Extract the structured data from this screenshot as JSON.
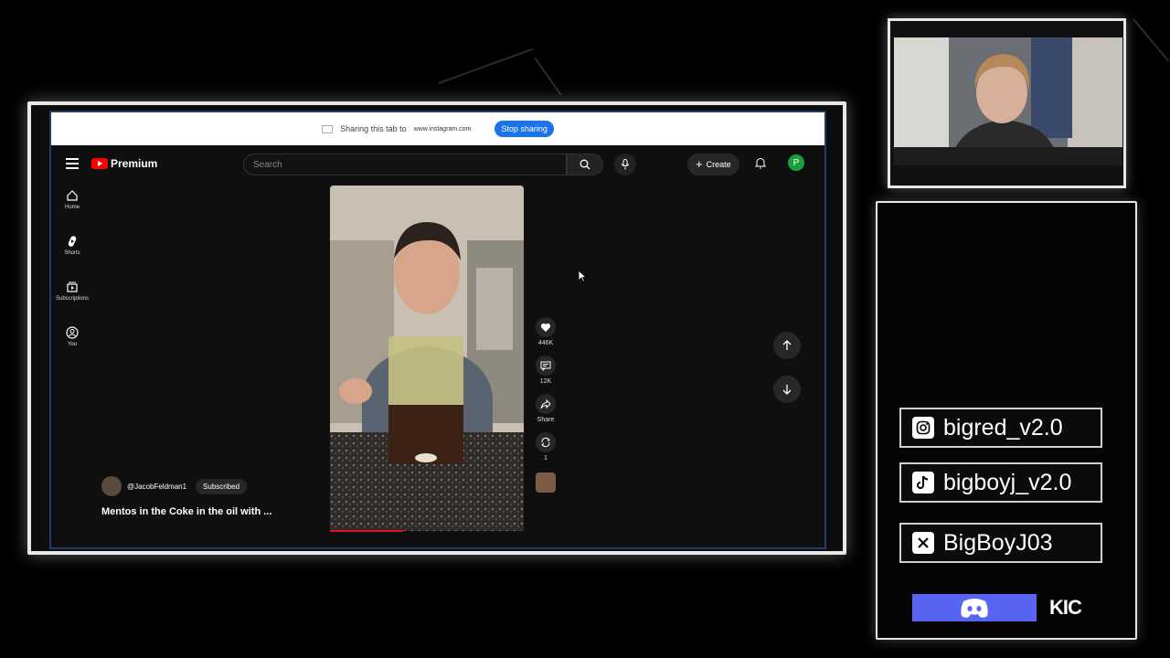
{
  "share_bar": {
    "message": "Sharing this tab to",
    "site": "www.instagram.com",
    "stop_label": "Stop sharing"
  },
  "youtube": {
    "logo_text": "Premium",
    "search_placeholder": "Search",
    "create_label": "Create",
    "avatar_letter": "P",
    "sidebar": [
      {
        "label": "Home",
        "icon": "home-icon"
      },
      {
        "label": "Shorts",
        "icon": "shorts-icon"
      },
      {
        "label": "Subscriptions",
        "icon": "subscriptions-icon"
      },
      {
        "label": "You",
        "icon": "you-icon"
      }
    ],
    "short": {
      "channel": "@JacobFeldman1",
      "subscribe_label": "Subscribed",
      "title": "Mentos in the Coke in the oil with ...",
      "likes": "446K",
      "comments": "12K",
      "share_label": "Share",
      "remix_count": "1"
    }
  },
  "socials": {
    "instagram": "bigred_v2.0",
    "tiktok": "bigboyj_v2.0",
    "x": "BigBoyJ03",
    "kick_label": "KIC"
  },
  "colors": {
    "accent_blue": "#1a73e8",
    "youtube_red": "#ff0000",
    "discord": "#5865f2"
  }
}
